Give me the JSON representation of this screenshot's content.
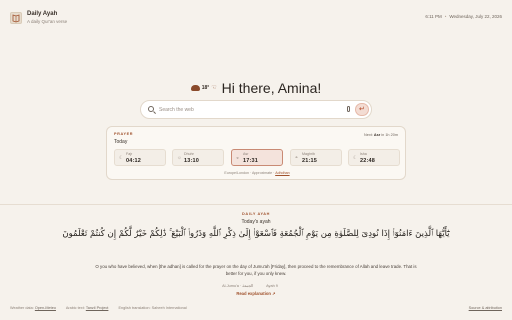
{
  "header": {
    "app_title": "Daily Ayah",
    "app_subtitle": "A daily Qur'an verse",
    "time": "6:11 PM",
    "separator": "•",
    "date": "Wednesday, July 22, 2026"
  },
  "greeting": {
    "weather_icon": "cloud-icon",
    "temperature": "18",
    "unit": "°",
    "hand_icon": "waving-hand-icon",
    "text": "Hi there, Amina!"
  },
  "search": {
    "placeholder": "Search the web",
    "value": "",
    "mic_icon": "mic-icon",
    "submit_icon": "enter-icon"
  },
  "prayer": {
    "label": "PRAYER",
    "day": "Today",
    "next_label": "Next:",
    "next_name": "Asr",
    "next_in": "in 1h 20m",
    "times": [
      {
        "name": "Fajr",
        "time": "04:12",
        "icon": "moon-icon",
        "active": false
      },
      {
        "name": "Dhuhr",
        "time": "13:10",
        "icon": "sun-icon",
        "active": false
      },
      {
        "name": "Asr",
        "time": "17:31",
        "icon": "sun-low-icon",
        "active": true
      },
      {
        "name": "Maghrib",
        "time": "21:15",
        "icon": "sunset-icon",
        "active": false
      },
      {
        "name": "Isha",
        "time": "22:48",
        "icon": "moon-icon",
        "active": false
      }
    ],
    "location": "Europe/London · Approximate ·",
    "location_link": "Adhdhan"
  },
  "ayah": {
    "label": "DAILY AYAH",
    "subtitle": "Today's ayah",
    "arabic": "يَٰٓأَيُّهَا ٱلَّذِينَ ءَامَنُوٓا۟ إِذَا نُودِىَ لِلصَّلَوٰةِ مِن يَوْمِ ٱلْجُمُعَةِ فَٱسْعَوْا۟ إِلَىٰ ذِكْرِ ٱللَّهِ وَذَرُوا۟ ٱلْبَيْعَ ۚ ذَٰلِكُمْ خَيْرٌ لَّكُمْ إِن كُنتُمْ تَعْلَمُونَ",
    "translation": "O you who have believed, when [the adhan] is called for the prayer on the day of Jumu'ah [Friday], then proceed to the remembrance of Allah and leave trade. That is better for you, if you only knew.",
    "surah_en": "Al-Jumu'a",
    "surah_ar": "الجمعة",
    "ayah_ref": "Ayah 9",
    "read_label": "Read explanation",
    "read_icon": "external-link-icon"
  },
  "footer": {
    "weather_label": "Weather data:",
    "weather_link": "Open-Meteo",
    "arabic_label": "Arabic text:",
    "arabic_link": "Tanzil Project",
    "translation_label": "English translation: Saheeh International",
    "source_link": "Source & attribution"
  },
  "colors": {
    "background": "#f6f2ec",
    "accent": "#a0522d",
    "active_prayer_bg": "#f4e3dc"
  }
}
